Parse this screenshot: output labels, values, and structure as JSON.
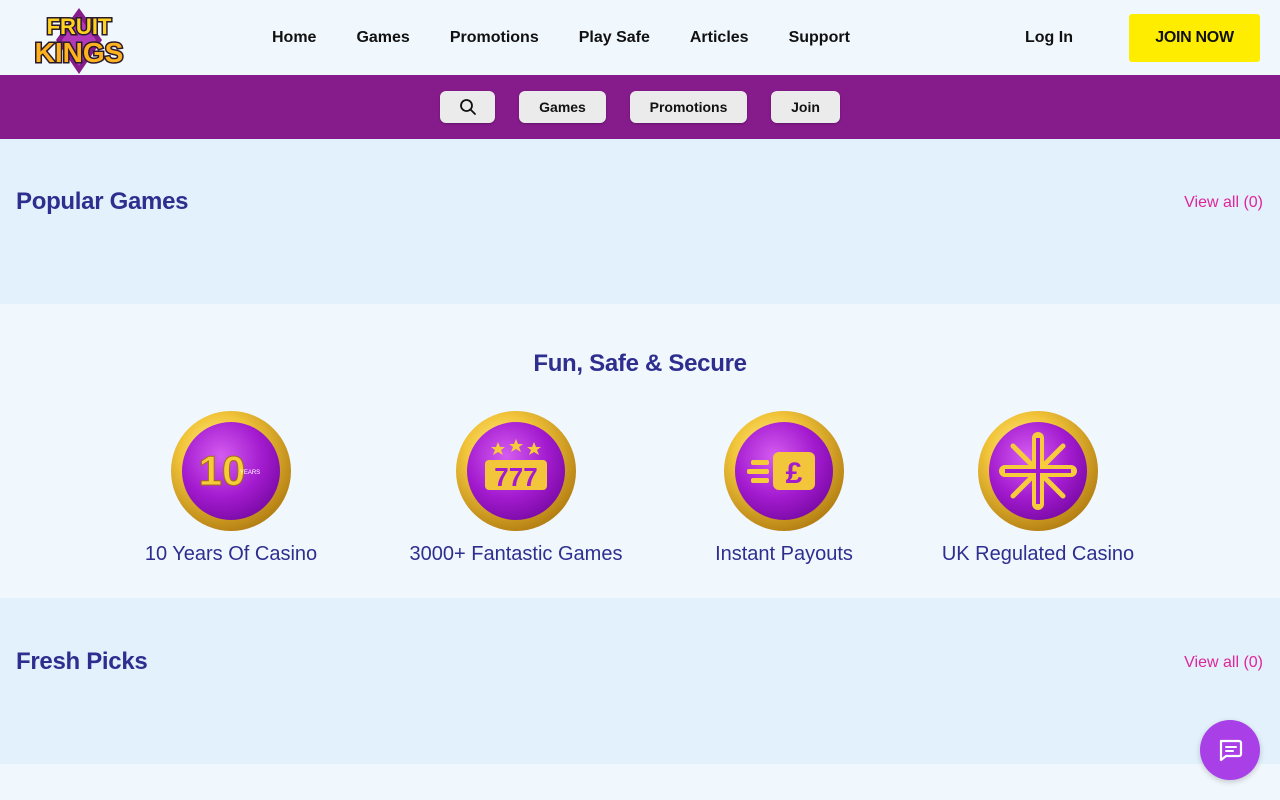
{
  "brand": {
    "logo_line1": "FRUIT",
    "logo_line2": "KINGS"
  },
  "nav": {
    "items": [
      {
        "label": "Home"
      },
      {
        "label": "Games"
      },
      {
        "label": "Promotions"
      },
      {
        "label": "Play Safe"
      },
      {
        "label": "Articles"
      },
      {
        "label": "Support"
      }
    ],
    "login_label": "Log In",
    "join_label": "JOIN NOW"
  },
  "subnav": {
    "search_icon": "search-icon",
    "items": [
      {
        "label": "Games"
      },
      {
        "label": "Promotions"
      },
      {
        "label": "Join"
      }
    ]
  },
  "sections": {
    "popular": {
      "title": "Popular Games",
      "view_all": "View all (0)"
    },
    "fun": {
      "title": "Fun, Safe & Secure",
      "features": [
        {
          "label": "10 Years Of Casino",
          "icon": "ten-years-icon",
          "badge_number": "10",
          "badge_text": "YEARS"
        },
        {
          "label": "3000+ Fantastic Games",
          "icon": "slot-777-icon",
          "badge_number": "777"
        },
        {
          "label": "Instant Payouts",
          "icon": "fast-pound-icon",
          "badge_number": "£"
        },
        {
          "label": "UK Regulated Casino",
          "icon": "union-jack-icon"
        }
      ]
    },
    "fresh": {
      "title": "Fresh Picks",
      "view_all": "View all (0)"
    }
  },
  "colors": {
    "brand_purple": "#861b8c",
    "join_yellow": "#ffed00",
    "heading_blue": "#2e2e8f",
    "link_pink": "#e0259b",
    "chat_purple": "#a93fe6"
  },
  "chat": {
    "icon": "chat-bubble-icon"
  }
}
